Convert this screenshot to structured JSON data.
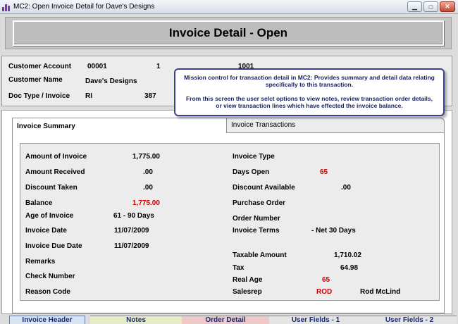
{
  "window": {
    "title": "MC2: Open Invoice Detail for Dave's Designs"
  },
  "header": {
    "title": "Invoice Detail - Open"
  },
  "customer": {
    "account_label": "Customer Account",
    "account_value": "00001",
    "account_extra1": "1",
    "account_extra2": "1001",
    "name_label": "Customer Name",
    "name_value": "Dave's Designs",
    "doctype_label": "Doc Type / Invoice",
    "doctype_value": "RI",
    "invoice_value": "387"
  },
  "tooltip": {
    "line1": "Mission control for transaction detail in MC2:  Provides summary and detail data relating specifically to this transaction.",
    "line2": "From this screen the user selct options to view notes, review transaction order details, or view transaction lines which have effected the invoice balance."
  },
  "tabs": {
    "summary": "Invoice Summary",
    "transactions": "Invoice Transactions"
  },
  "summary_left": [
    {
      "label": "Amount of Invoice",
      "value": "1,775.00",
      "red": false
    },
    {
      "label": "Amount Received",
      "value": ".00",
      "red": false
    },
    {
      "label": "Discount Taken",
      "value": ".00",
      "red": false
    },
    {
      "label": "Balance",
      "value": "1,775.00",
      "red": true
    },
    {
      "label": "Age of Invoice",
      "value": "61 - 90 Days",
      "red": false
    },
    {
      "label": "Invoice Date",
      "value": "11/07/2009",
      "red": false
    },
    {
      "label": "Invoice Due Date",
      "value": "11/07/2009",
      "red": false
    },
    {
      "label": "Remarks",
      "value": "",
      "red": false
    },
    {
      "label": "Check Number",
      "value": "",
      "red": false
    },
    {
      "label": "Reason Code",
      "value": "",
      "red": false
    }
  ],
  "summary_right": {
    "invoice_type_label": "Invoice Type",
    "days_open_label": "Days Open",
    "days_open_value": "65",
    "discount_available_label": "Discount Available",
    "discount_available_value": ".00",
    "purchase_order_label": "Purchase Order",
    "order_number_label": "Order Number",
    "invoice_terms_label": "Invoice Terms",
    "invoice_terms_value": "- Net 30 Days",
    "taxable_amount_label": "Taxable Amount",
    "taxable_amount_value": "1,710.02",
    "tax_label": "Tax",
    "tax_value": "64.98",
    "real_age_label": "Real Age",
    "real_age_value": "65",
    "salesrep_label": "Salesrep",
    "salesrep_code": "ROD",
    "salesrep_name": "Rod McLind"
  },
  "bottom_tabs": [
    "Invoice Header",
    "Notes",
    "Order Detail",
    "User Fields - 1",
    "User Fields - 2"
  ],
  "colors": {
    "accent_red": "#d00000",
    "tooltip_border": "#3b4390"
  }
}
